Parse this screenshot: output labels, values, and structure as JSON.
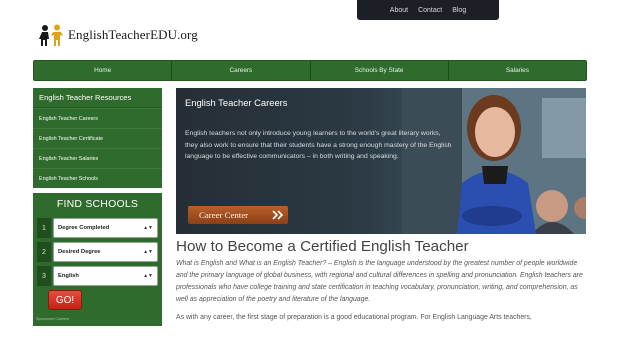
{
  "top_links": [
    "About",
    "Contact",
    "Blog"
  ],
  "logo": {
    "text": "EnglishTeacherEDU.org"
  },
  "nav": [
    "Home",
    "Careers",
    "Schools By State",
    "Salaries"
  ],
  "resources": {
    "title": "English Teacher Resources",
    "items": [
      "English Teacher Careers",
      "English Teacher Certificate",
      "English Teacher Salaries",
      "English Teacher Schools"
    ]
  },
  "find_schools": {
    "title": "FIND SCHOOLS",
    "rows": [
      {
        "num": "1",
        "value": "Degree Completed"
      },
      {
        "num": "2",
        "value": "Desired Degree"
      },
      {
        "num": "3",
        "value": "English"
      }
    ],
    "go_label": "GO!",
    "sponsored": "Sponsored Content"
  },
  "hero": {
    "title": "English Teacher Careers",
    "text": "English teachers not only introduce young learners to the world's great literary works, they also work to ensure that their students have a strong enough mastery of the English language to be effective communicators – in both writing and speaking.",
    "button": "Career Center"
  },
  "article": {
    "title": "How to Become a Certified English Teacher",
    "para1": "What is English and What is an English Teacher? – English is the language understood by the greatest number of people worldwide and the primary language of global business, with regional and cultural differences in spelling and pronunciation. English teachers are professionals who have college training and state certification in teaching vocabulary, pronunciation, writing, and comprehension, as well as appreciation of the poetry and literature of the language.",
    "para2": "As with any career, the first stage of preparation is a good educational program. For English Language Arts teachers,"
  },
  "colors": {
    "nav_green": "#2f6b2c",
    "go_red": "#d23a2c",
    "hero_dark": "#252e35",
    "career_button": "#a85126"
  }
}
